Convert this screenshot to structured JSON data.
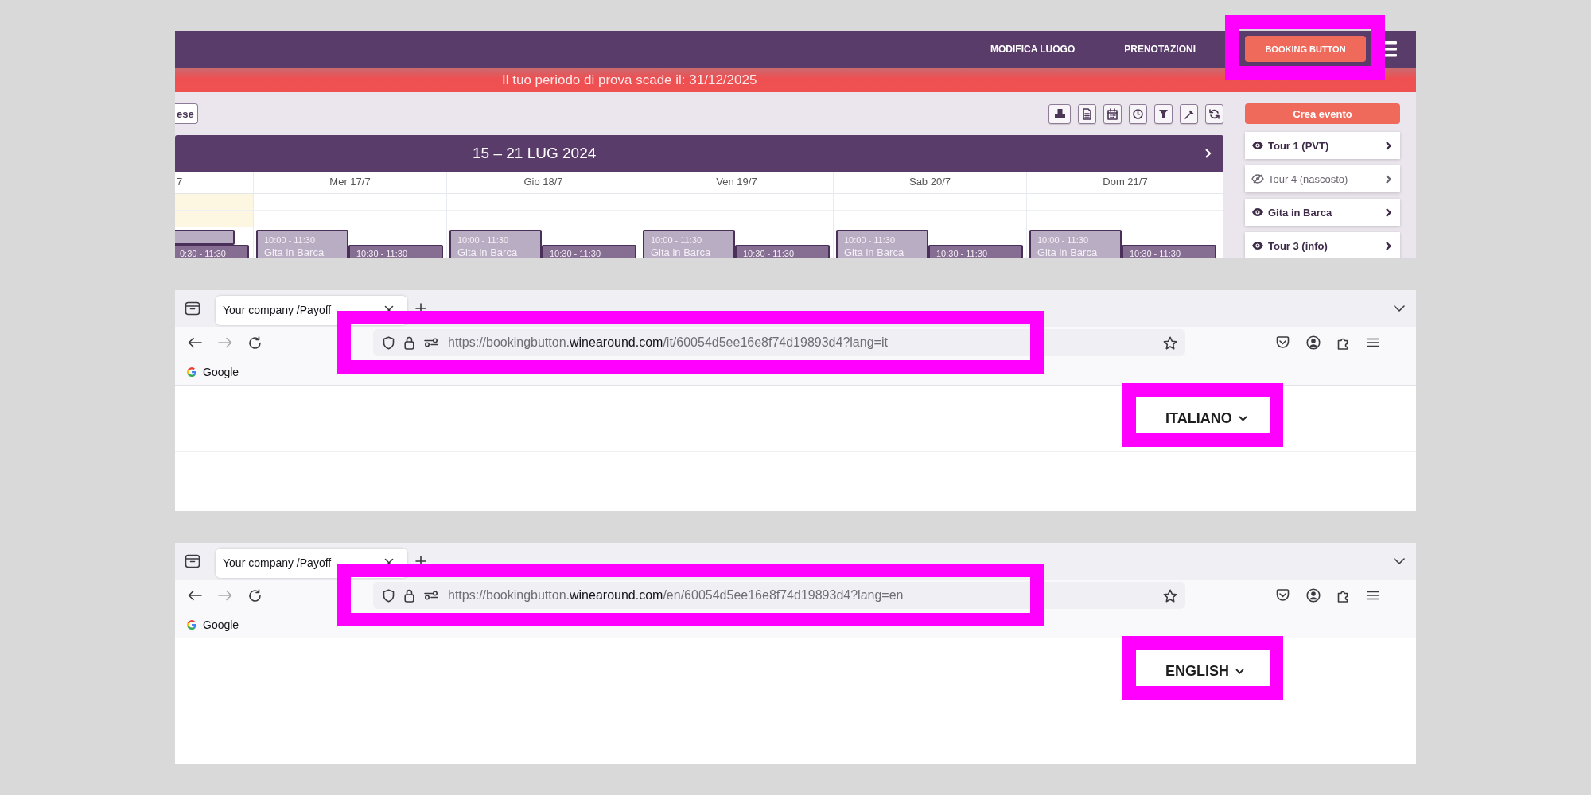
{
  "panels": [
    {
      "kind": "app",
      "nav": {
        "links": [
          "MODIFICA LUOGO",
          "PRENOTAZIONI"
        ],
        "booking_button": {
          "label": "BOOKING BUTTON",
          "highlighted": true
        }
      },
      "banner": "Il tuo periodo di prova scade il: 31/12/2025",
      "toolbar": {
        "view_button": "ese"
      },
      "calendar": {
        "title": "15 – 21 LUG 2024",
        "days": [
          {
            "label": "7",
            "partial": true,
            "today": true,
            "events": [
              {
                "kind": "main"
              },
              {
                "kind": "overlap",
                "time": "0:30 - 11:30"
              }
            ]
          },
          {
            "label": "Mer 17/7",
            "partial": false,
            "today": false,
            "events": [
              {
                "kind": "main",
                "time": "10:00 - 11:30",
                "title": "Gita in Barca"
              },
              {
                "kind": "overlap",
                "time": "10:30 - 11:30"
              }
            ]
          },
          {
            "label": "Gio 18/7",
            "partial": false,
            "today": false,
            "events": [
              {
                "kind": "main",
                "time": "10:00 - 11:30",
                "title": "Gita in Barca"
              },
              {
                "kind": "overlap",
                "time": "10:30 - 11:30"
              }
            ]
          },
          {
            "label": "Ven 19/7",
            "partial": false,
            "today": false,
            "events": [
              {
                "kind": "main",
                "time": "10:00 - 11:30",
                "title": "Gita in Barca"
              },
              {
                "kind": "overlap",
                "time": "10:30 - 11:30"
              }
            ]
          },
          {
            "label": "Sab 20/7",
            "partial": false,
            "today": false,
            "events": [
              {
                "kind": "main",
                "time": "10:00 - 11:30",
                "title": "Gita in Barca"
              },
              {
                "kind": "overlap",
                "time": "10:30 - 11:30"
              }
            ]
          },
          {
            "label": "Dom 21/7",
            "partial": false,
            "today": false,
            "events": [
              {
                "kind": "main",
                "time": "10:00 - 11:30",
                "title": "Gita in Barca"
              },
              {
                "kind": "overlap",
                "time": "10:30 - 11:30"
              }
            ]
          }
        ]
      },
      "sidebar": {
        "create_button": "Crea evento",
        "tours": [
          {
            "name": "Tour 1 (PVT)",
            "hidden": false
          },
          {
            "name": "Tour 4 (nascosto)",
            "hidden": true
          },
          {
            "name": "Gita in Barca",
            "hidden": false
          },
          {
            "name": "Tour 3 (info)",
            "hidden": false
          }
        ]
      }
    },
    {
      "kind": "browser",
      "tab": {
        "title": "Your company /Payoff"
      },
      "url": {
        "prefix": "https://bookingbutton.",
        "domain": "winearound.com",
        "path": "/it/60054d5ee16e8f74d19893d4?lang=it",
        "highlighted": true
      },
      "bookmarks": [
        "Google"
      ],
      "language": {
        "label": "ITALIANO",
        "highlighted": true
      }
    },
    {
      "kind": "browser",
      "tab": {
        "title": "Your company /Payoff"
      },
      "url": {
        "prefix": "https://bookingbutton.",
        "domain": "winearound.com",
        "path": "/en/60054d5ee16e8f74d19893d4?lang=en",
        "highlighted": true
      },
      "bookmarks": [
        "Google"
      ],
      "language": {
        "label": "ENGLISH",
        "highlighted": true
      }
    }
  ]
}
